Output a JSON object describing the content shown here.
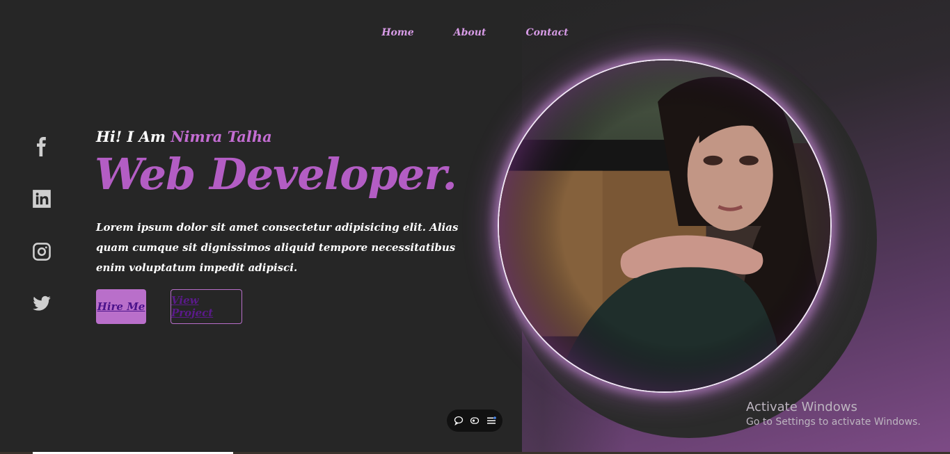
{
  "nav": {
    "items": [
      {
        "label": "Home"
      },
      {
        "label": "About"
      },
      {
        "label": "Contact"
      }
    ]
  },
  "social": {
    "icons": [
      "facebook-icon",
      "linkedin-icon",
      "instagram-icon",
      "twitter-icon"
    ]
  },
  "hero": {
    "greeting": "Hi! I Am",
    "name": "Nimra Talha",
    "title": "Web Developer.",
    "description": "Lorem ipsum dolor sit amet consectetur adipisicing elit. Alias quam cumque sit dignissimos aliquid tempore necessitatibus enim voluptatum impedit adipisci.",
    "hire_button": "Hire Me",
    "view_button": "View Project"
  },
  "watermark": {
    "line1": "Activate Windows",
    "line2": "Go to Settings to activate Windows."
  },
  "toolbar": {
    "icons": [
      "chat-icon",
      "capture-icon",
      "menu-icon"
    ]
  },
  "colors": {
    "accent": "#b35dc4",
    "nav": "#d79be6",
    "background": "#262626"
  }
}
